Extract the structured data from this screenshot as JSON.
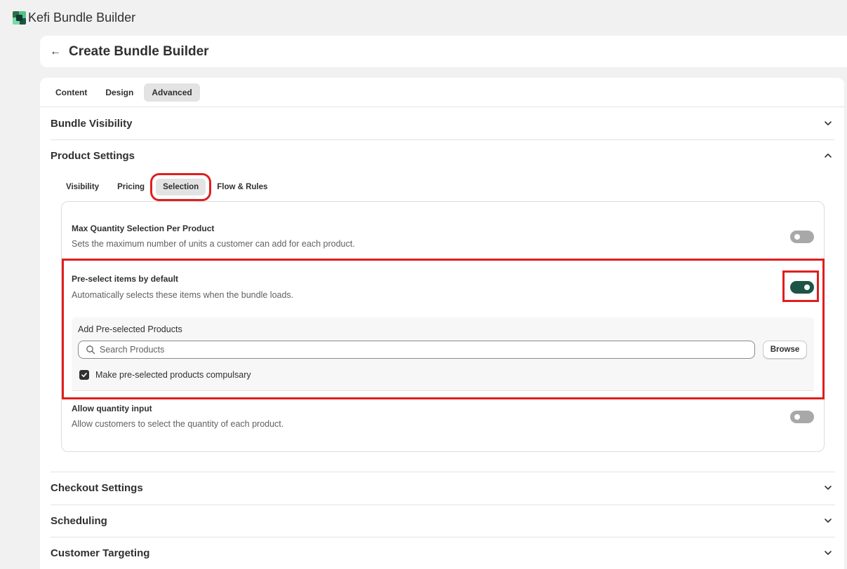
{
  "app": {
    "title": "Kefi Bundle Builder"
  },
  "page": {
    "title": "Create Bundle Builder"
  },
  "tabs": [
    {
      "label": "Content",
      "active": false
    },
    {
      "label": "Design",
      "active": false
    },
    {
      "label": "Advanced",
      "active": true
    }
  ],
  "sections": {
    "bundle_visibility": "Bundle Visibility",
    "product_settings": "Product Settings",
    "checkout_settings": "Checkout Settings",
    "scheduling": "Scheduling",
    "customer_targeting": "Customer Targeting"
  },
  "subtabs": [
    {
      "label": "Visibility",
      "active": false
    },
    {
      "label": "Pricing",
      "active": false
    },
    {
      "label": "Selection",
      "active": true
    },
    {
      "label": "Flow & Rules",
      "active": false
    }
  ],
  "settings": {
    "max_quantity": {
      "title": "Max Quantity Selection Per Product",
      "description": "Sets the maximum number of units a customer can add for each product.",
      "enabled": false
    },
    "preselect": {
      "title": "Pre-select items by default",
      "description": "Automatically selects these items when the bundle loads.",
      "enabled": true,
      "panel_label": "Add Pre-selected Products",
      "search_placeholder": "Search Products",
      "browse_label": "Browse",
      "compulsory_label": "Make pre-selected products compulsary",
      "compulsory_checked": true
    },
    "allow_quantity": {
      "title": "Allow quantity input",
      "description": "Allow customers to select the quantity of each product.",
      "enabled": false
    }
  },
  "colors": {
    "accent_toggle_on": "#1c5446",
    "highlight": "#e01e1e"
  }
}
